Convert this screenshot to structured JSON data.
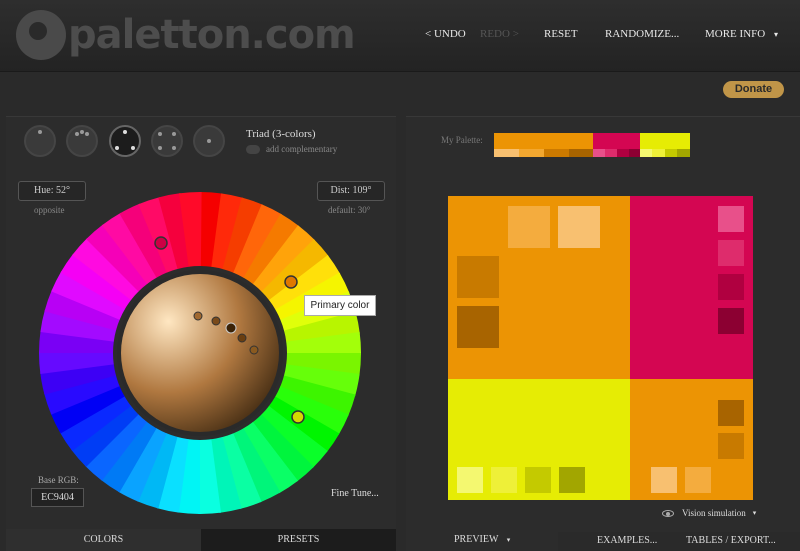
{
  "header": {
    "logo_text": "paletton.com",
    "nav": {
      "undo": "< UNDO",
      "redo": "REDO >",
      "reset": "RESET",
      "randomize": "RANDOMIZE...",
      "more_info": "MORE INFO",
      "more_info_caret": "▾"
    }
  },
  "donate_label": "Donate",
  "scheme": {
    "label": "Triad (3-colors)",
    "complementary_label": "add complementary"
  },
  "hue": {
    "field": "Hue: 52°",
    "note": "opposite"
  },
  "dist": {
    "field": "Dist: 109°",
    "note": "default: 30°"
  },
  "tooltip": "Primary color",
  "base_rgb": {
    "label": "Base RGB:",
    "value": "EC9404"
  },
  "fine_tune": "Fine Tune...",
  "left_tabs": {
    "colors": "COLORS",
    "presets": "PRESETS"
  },
  "palette": {
    "label": "My Palette:",
    "colors": {
      "primary": "#EC9404",
      "secondary": "#D40652",
      "tertiary": "#E6EC04"
    }
  },
  "vision_simulation": "Vision simulation",
  "vision_caret": "▾",
  "right_tabs": {
    "preview": "PREVIEW",
    "preview_caret": "▾",
    "examples": "EXAMPLES...",
    "tables": "TABLES / EXPORT..."
  }
}
